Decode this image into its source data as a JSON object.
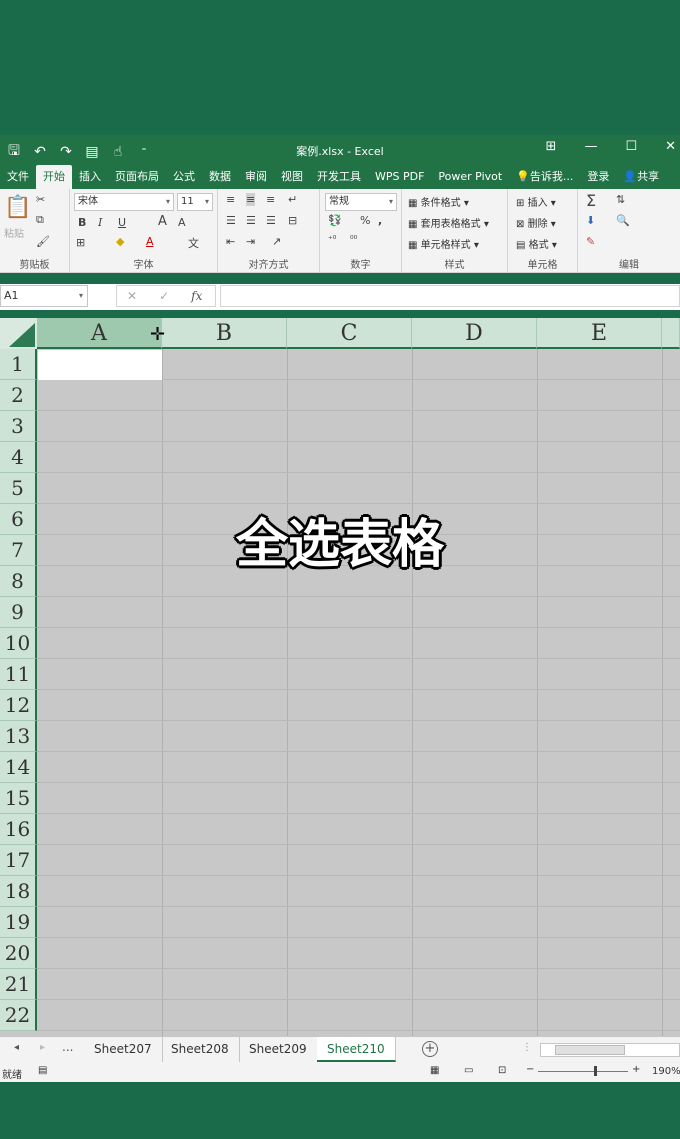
{
  "titlebar": {
    "title": "案例.xlsx - Excel",
    "qat_icons": [
      "save-icon",
      "undo-icon",
      "redo-icon",
      "form-icon",
      "touch-mode-icon",
      "customize-icon"
    ]
  },
  "menubar": {
    "tabs": [
      "文件",
      "开始",
      "插入",
      "页面布局",
      "公式",
      "数据",
      "审阅",
      "视图",
      "开发工具",
      "WPS PDF",
      "Power Pivot"
    ],
    "tell_me": "告诉我...",
    "login": "登录",
    "share": "共享"
  },
  "ribbon": {
    "clipboard": {
      "label": "剪贴板",
      "paste": "粘贴"
    },
    "font": {
      "label": "字体",
      "font_name": "宋体",
      "font_size": "11",
      "bold": "B",
      "italic": "I",
      "underline": "U",
      "grow": "A",
      "shrink": "A",
      "font_color": "A",
      "phonetic": "文"
    },
    "alignment": {
      "label": "对齐方式"
    },
    "number": {
      "label": "数字",
      "format": "常规",
      "percent": "%",
      "comma": ","
    },
    "styles": {
      "label": "样式",
      "conditional": "条件格式",
      "table": "套用表格格式",
      "cell_styles": "单元格样式"
    },
    "cells": {
      "label": "单元格",
      "insert": "插入",
      "delete": "删除",
      "format": "格式"
    },
    "editing": {
      "label": "编辑"
    }
  },
  "formula_bar": {
    "name_box": "A1",
    "cancel": "✕",
    "enter": "✓",
    "fx": "fx",
    "content": ""
  },
  "grid": {
    "columns": [
      "A",
      "B",
      "C",
      "D",
      "E"
    ],
    "rows": [
      "1",
      "2",
      "3",
      "4",
      "5",
      "6",
      "7",
      "8",
      "9",
      "10",
      "11",
      "12",
      "13",
      "14",
      "15",
      "16",
      "17",
      "18",
      "19",
      "20",
      "21",
      "22"
    ],
    "overlay_caption": "全选表格"
  },
  "sheets": {
    "more": "...",
    "tabs": [
      "Sheet207",
      "Sheet208",
      "Sheet209",
      "Sheet210"
    ],
    "active": "Sheet210"
  },
  "status": {
    "ready": "就绪",
    "zoom": "190%"
  }
}
